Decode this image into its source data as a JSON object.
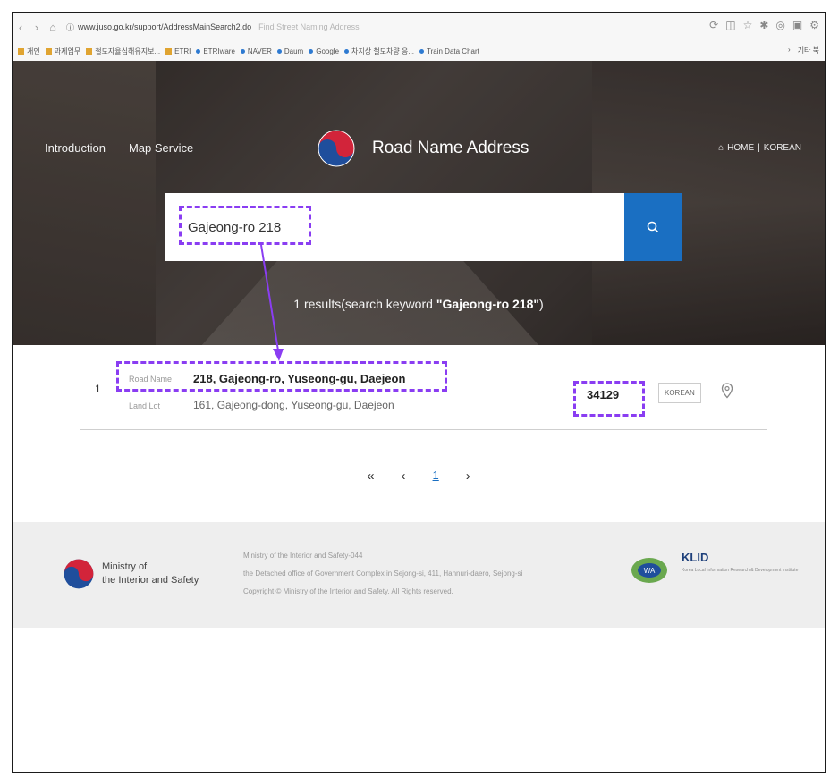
{
  "browser": {
    "url": "www.juso.go.kr/support/AddressMainSearch2.do",
    "page_title": "Find Street Naming Address",
    "bookmarks": [
      "개인",
      "과제업무",
      "철도자율심해유지보...",
      "ETRI",
      "ETRIware",
      "NAVER",
      "Daum",
      "Google",
      "차지상 철도차량 응...",
      "Train Data Chart"
    ],
    "bookmarks_more": "기타 북"
  },
  "header": {
    "nav": [
      "Introduction",
      "Map Service"
    ],
    "site_title": "Road Name Address",
    "home_label": "HOME",
    "lang_label": "KOREAN"
  },
  "search": {
    "query": "Gajeong-ro 218",
    "result_prefix": "1 results(search keyword ",
    "result_keyword": "\"Gajeong-ro 218\"",
    "result_suffix": ")"
  },
  "result": {
    "index": "1",
    "road_label": "Road Name",
    "road_address": "218, Gajeong-ro, Yuseong-gu, Daejeon",
    "lot_label": "Land Lot",
    "lot_address": "161, Gajeong-dong, Yuseong-gu, Daejeon",
    "zip": "34129",
    "korean_button": "KOREAN"
  },
  "pager": {
    "first": "«",
    "prev": "‹",
    "current": "1",
    "next": "›"
  },
  "footer": {
    "ministry_line1": "Ministry of",
    "ministry_line2": "the Interior and Safety",
    "info_line1": "Ministry of the Interior and Safety-044",
    "info_line2": "the Detached office of Government Complex in Sejong-si, 411, Hannuri-daero, Sejong-si",
    "info_line3": "Copyright © Ministry of the Interior and Safety. All Rights reserved.",
    "partner_logo": "KLID",
    "partner_sub": "Korea Local Information Research & Development Institute"
  },
  "colors": {
    "accent": "#1a6fc2",
    "annotation": "#8a3df2"
  }
}
